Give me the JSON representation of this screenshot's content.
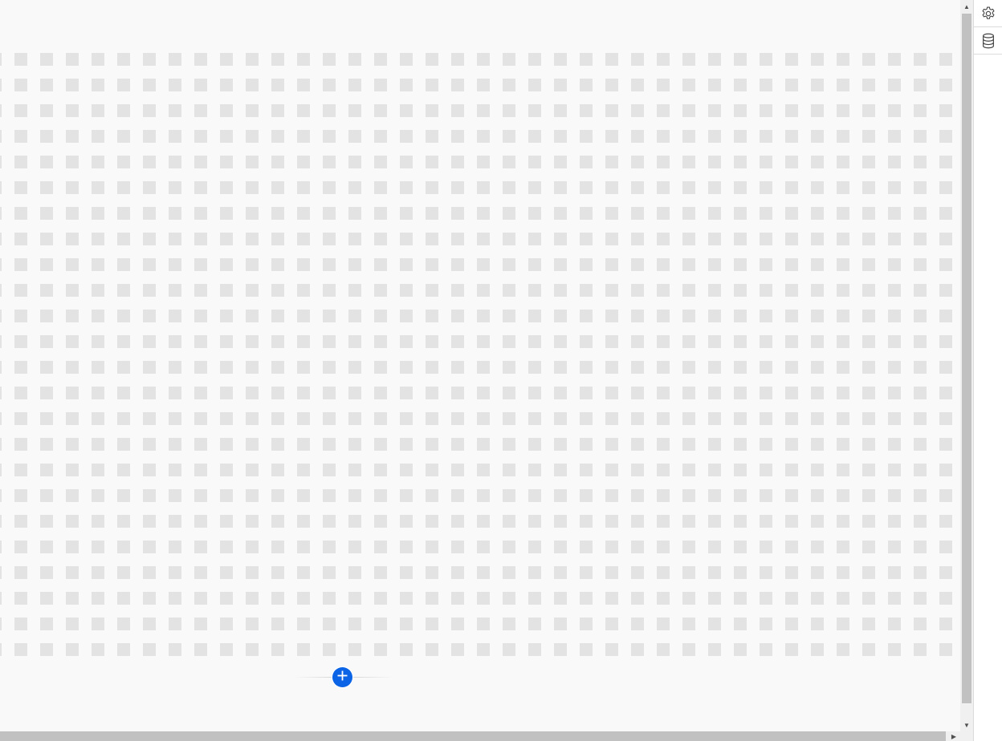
{
  "canvas": {
    "background": "#f9f9f9",
    "dot_color": "#e3e3e3"
  },
  "add_row": {
    "icon": "plus-icon",
    "color": "#0b63e5"
  },
  "toolbar": {
    "items": [
      {
        "icon": "gear-icon"
      },
      {
        "icon": "database-icon"
      }
    ]
  },
  "scrollbars": {
    "vertical": {
      "up_icon": "triangle-up-icon",
      "down_icon": "triangle-down-icon"
    },
    "horizontal": {
      "right_icon": "triangle-right-icon"
    }
  }
}
